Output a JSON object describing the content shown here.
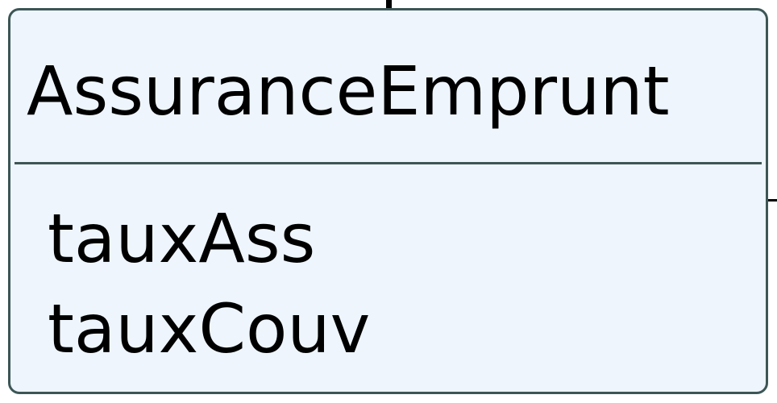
{
  "class_box": {
    "name": "AssuranceEmprunt",
    "attributes": [
      "tauxAss",
      "tauxCouv"
    ]
  },
  "colors": {
    "box_fill": "#eef5fc",
    "box_border": "#3d5656",
    "text": "#000000"
  }
}
